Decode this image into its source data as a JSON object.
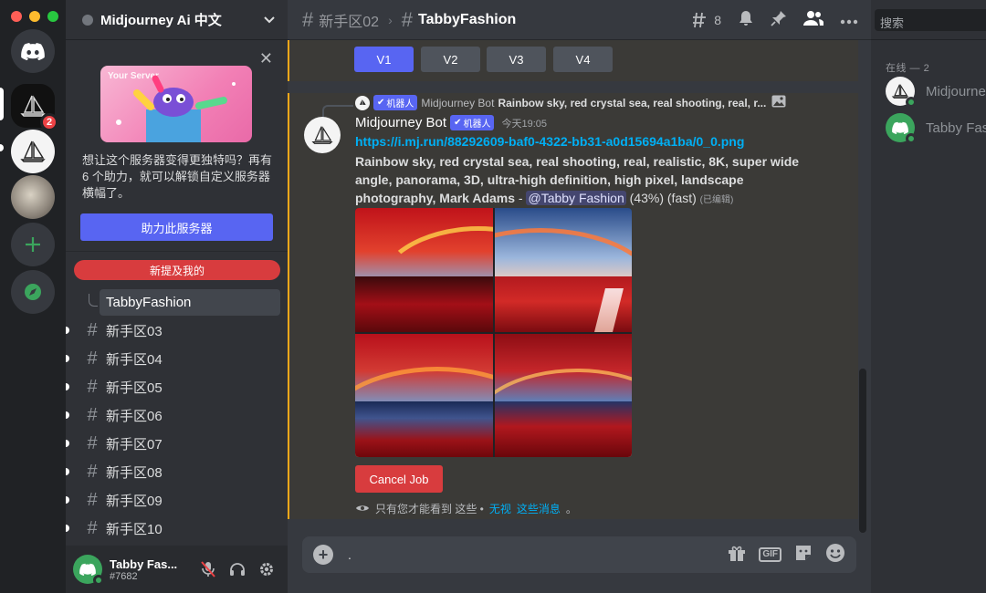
{
  "window": {
    "traffic_colors": [
      "#ff5f57",
      "#febc2e",
      "#28c840"
    ]
  },
  "rail": {
    "mj1_badge": "2",
    "icons": [
      "discord-home-icon",
      "midjourney-server-icon",
      "midjourney-server-icon",
      "cat-server-icon",
      "add-server-icon",
      "explore-icon"
    ]
  },
  "server": {
    "name": "Midjourney Ai 中文"
  },
  "boost": {
    "image_label": "Your Server",
    "text": "想让这个服务器变得更独特吗？再有 6 个助力，就可以解锁自定义服务器横幅了。",
    "button": "助力此服务器"
  },
  "sidebar": {
    "mentions_pill": "新提及我的",
    "thread": "TabbyFashion",
    "channels": [
      "新手区03",
      "新手区04",
      "新手区05",
      "新手区06",
      "新手区07",
      "新手区08",
      "新手区09",
      "新手区10"
    ]
  },
  "user": {
    "name": "Tabby Fas...",
    "tag": "#7682"
  },
  "topbar": {
    "parent": "新手区02",
    "current": "TabbyFashion",
    "threads_count": "8"
  },
  "variations": [
    "V1",
    "V2",
    "V3",
    "V4"
  ],
  "message": {
    "reply_bot_tag": "机器人",
    "reply_name": "Midjourney Bot",
    "reply_text": "Rainbow sky, red crystal sea, real shooting, real, r...",
    "author": "Midjourney Bot",
    "bot_tag": "机器人",
    "time": "今天19:05",
    "link": "https://i.mj.run/88292609-baf0-4322-bb31-a0d15694a1ba/0_0.png",
    "prompt": "Rainbow sky, red crystal sea, real shooting, real, realistic, 8K, super wide angle, panorama, 3D, ultra-high definition, high pixel, landscape photography, Mark Adams",
    "dash": " - ",
    "mention": "@Tabby Fashion",
    "progress": " (43%) (fast) ",
    "edited": "(已编辑)",
    "cancel": "Cancel Job",
    "ephemeral": "只有您才能看到 这些 •",
    "dismiss": "无视",
    "these_msgs": "这些消息",
    "end": "。"
  },
  "composer": {
    "value": "."
  },
  "members": {
    "search_placeholder": "搜索",
    "header": "在线 — 2",
    "list": [
      {
        "name": "Midjourney Bot"
      },
      {
        "name": "Tabby Fashion"
      }
    ]
  },
  "colors": {
    "blurple": "#5865f2",
    "red": "#d83c3e",
    "green": "#3ba55d",
    "link": "#00aff4",
    "highlight": "#faa81a"
  }
}
